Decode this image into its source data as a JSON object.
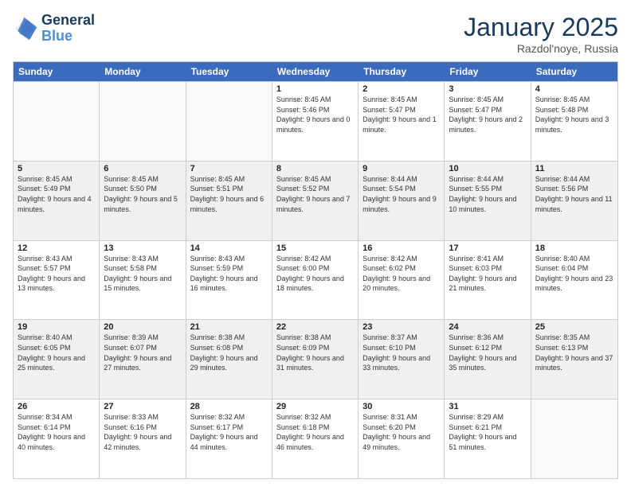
{
  "logo": {
    "line1": "General",
    "line2": "Blue"
  },
  "title": "January 2025",
  "location": "Razdol'noye, Russia",
  "header_days": [
    "Sunday",
    "Monday",
    "Tuesday",
    "Wednesday",
    "Thursday",
    "Friday",
    "Saturday"
  ],
  "weeks": [
    [
      {
        "day": "",
        "sunrise": "",
        "sunset": "",
        "daylight": "",
        "shaded": false,
        "empty": true
      },
      {
        "day": "",
        "sunrise": "",
        "sunset": "",
        "daylight": "",
        "shaded": false,
        "empty": true
      },
      {
        "day": "",
        "sunrise": "",
        "sunset": "",
        "daylight": "",
        "shaded": false,
        "empty": true
      },
      {
        "day": "1",
        "sunrise": "Sunrise: 8:45 AM",
        "sunset": "Sunset: 5:46 PM",
        "daylight": "Daylight: 9 hours and 0 minutes.",
        "shaded": false,
        "empty": false
      },
      {
        "day": "2",
        "sunrise": "Sunrise: 8:45 AM",
        "sunset": "Sunset: 5:47 PM",
        "daylight": "Daylight: 9 hours and 1 minute.",
        "shaded": false,
        "empty": false
      },
      {
        "day": "3",
        "sunrise": "Sunrise: 8:45 AM",
        "sunset": "Sunset: 5:47 PM",
        "daylight": "Daylight: 9 hours and 2 minutes.",
        "shaded": false,
        "empty": false
      },
      {
        "day": "4",
        "sunrise": "Sunrise: 8:45 AM",
        "sunset": "Sunset: 5:48 PM",
        "daylight": "Daylight: 9 hours and 3 minutes.",
        "shaded": false,
        "empty": false
      }
    ],
    [
      {
        "day": "5",
        "sunrise": "Sunrise: 8:45 AM",
        "sunset": "Sunset: 5:49 PM",
        "daylight": "Daylight: 9 hours and 4 minutes.",
        "shaded": true,
        "empty": false
      },
      {
        "day": "6",
        "sunrise": "Sunrise: 8:45 AM",
        "sunset": "Sunset: 5:50 PM",
        "daylight": "Daylight: 9 hours and 5 minutes.",
        "shaded": true,
        "empty": false
      },
      {
        "day": "7",
        "sunrise": "Sunrise: 8:45 AM",
        "sunset": "Sunset: 5:51 PM",
        "daylight": "Daylight: 9 hours and 6 minutes.",
        "shaded": true,
        "empty": false
      },
      {
        "day": "8",
        "sunrise": "Sunrise: 8:45 AM",
        "sunset": "Sunset: 5:52 PM",
        "daylight": "Daylight: 9 hours and 7 minutes.",
        "shaded": true,
        "empty": false
      },
      {
        "day": "9",
        "sunrise": "Sunrise: 8:44 AM",
        "sunset": "Sunset: 5:54 PM",
        "daylight": "Daylight: 9 hours and 9 minutes.",
        "shaded": true,
        "empty": false
      },
      {
        "day": "10",
        "sunrise": "Sunrise: 8:44 AM",
        "sunset": "Sunset: 5:55 PM",
        "daylight": "Daylight: 9 hours and 10 minutes.",
        "shaded": true,
        "empty": false
      },
      {
        "day": "11",
        "sunrise": "Sunrise: 8:44 AM",
        "sunset": "Sunset: 5:56 PM",
        "daylight": "Daylight: 9 hours and 11 minutes.",
        "shaded": true,
        "empty": false
      }
    ],
    [
      {
        "day": "12",
        "sunrise": "Sunrise: 8:43 AM",
        "sunset": "Sunset: 5:57 PM",
        "daylight": "Daylight: 9 hours and 13 minutes.",
        "shaded": false,
        "empty": false
      },
      {
        "day": "13",
        "sunrise": "Sunrise: 8:43 AM",
        "sunset": "Sunset: 5:58 PM",
        "daylight": "Daylight: 9 hours and 15 minutes.",
        "shaded": false,
        "empty": false
      },
      {
        "day": "14",
        "sunrise": "Sunrise: 8:43 AM",
        "sunset": "Sunset: 5:59 PM",
        "daylight": "Daylight: 9 hours and 16 minutes.",
        "shaded": false,
        "empty": false
      },
      {
        "day": "15",
        "sunrise": "Sunrise: 8:42 AM",
        "sunset": "Sunset: 6:00 PM",
        "daylight": "Daylight: 9 hours and 18 minutes.",
        "shaded": false,
        "empty": false
      },
      {
        "day": "16",
        "sunrise": "Sunrise: 8:42 AM",
        "sunset": "Sunset: 6:02 PM",
        "daylight": "Daylight: 9 hours and 20 minutes.",
        "shaded": false,
        "empty": false
      },
      {
        "day": "17",
        "sunrise": "Sunrise: 8:41 AM",
        "sunset": "Sunset: 6:03 PM",
        "daylight": "Daylight: 9 hours and 21 minutes.",
        "shaded": false,
        "empty": false
      },
      {
        "day": "18",
        "sunrise": "Sunrise: 8:40 AM",
        "sunset": "Sunset: 6:04 PM",
        "daylight": "Daylight: 9 hours and 23 minutes.",
        "shaded": false,
        "empty": false
      }
    ],
    [
      {
        "day": "19",
        "sunrise": "Sunrise: 8:40 AM",
        "sunset": "Sunset: 6:05 PM",
        "daylight": "Daylight: 9 hours and 25 minutes.",
        "shaded": true,
        "empty": false
      },
      {
        "day": "20",
        "sunrise": "Sunrise: 8:39 AM",
        "sunset": "Sunset: 6:07 PM",
        "daylight": "Daylight: 9 hours and 27 minutes.",
        "shaded": true,
        "empty": false
      },
      {
        "day": "21",
        "sunrise": "Sunrise: 8:38 AM",
        "sunset": "Sunset: 6:08 PM",
        "daylight": "Daylight: 9 hours and 29 minutes.",
        "shaded": true,
        "empty": false
      },
      {
        "day": "22",
        "sunrise": "Sunrise: 8:38 AM",
        "sunset": "Sunset: 6:09 PM",
        "daylight": "Daylight: 9 hours and 31 minutes.",
        "shaded": true,
        "empty": false
      },
      {
        "day": "23",
        "sunrise": "Sunrise: 8:37 AM",
        "sunset": "Sunset: 6:10 PM",
        "daylight": "Daylight: 9 hours and 33 minutes.",
        "shaded": true,
        "empty": false
      },
      {
        "day": "24",
        "sunrise": "Sunrise: 8:36 AM",
        "sunset": "Sunset: 6:12 PM",
        "daylight": "Daylight: 9 hours and 35 minutes.",
        "shaded": true,
        "empty": false
      },
      {
        "day": "25",
        "sunrise": "Sunrise: 8:35 AM",
        "sunset": "Sunset: 6:13 PM",
        "daylight": "Daylight: 9 hours and 37 minutes.",
        "shaded": true,
        "empty": false
      }
    ],
    [
      {
        "day": "26",
        "sunrise": "Sunrise: 8:34 AM",
        "sunset": "Sunset: 6:14 PM",
        "daylight": "Daylight: 9 hours and 40 minutes.",
        "shaded": false,
        "empty": false
      },
      {
        "day": "27",
        "sunrise": "Sunrise: 8:33 AM",
        "sunset": "Sunset: 6:16 PM",
        "daylight": "Daylight: 9 hours and 42 minutes.",
        "shaded": false,
        "empty": false
      },
      {
        "day": "28",
        "sunrise": "Sunrise: 8:32 AM",
        "sunset": "Sunset: 6:17 PM",
        "daylight": "Daylight: 9 hours and 44 minutes.",
        "shaded": false,
        "empty": false
      },
      {
        "day": "29",
        "sunrise": "Sunrise: 8:32 AM",
        "sunset": "Sunset: 6:18 PM",
        "daylight": "Daylight: 9 hours and 46 minutes.",
        "shaded": false,
        "empty": false
      },
      {
        "day": "30",
        "sunrise": "Sunrise: 8:31 AM",
        "sunset": "Sunset: 6:20 PM",
        "daylight": "Daylight: 9 hours and 49 minutes.",
        "shaded": false,
        "empty": false
      },
      {
        "day": "31",
        "sunrise": "Sunrise: 8:29 AM",
        "sunset": "Sunset: 6:21 PM",
        "daylight": "Daylight: 9 hours and 51 minutes.",
        "shaded": false,
        "empty": false
      },
      {
        "day": "",
        "sunrise": "",
        "sunset": "",
        "daylight": "",
        "shaded": false,
        "empty": true
      }
    ]
  ]
}
